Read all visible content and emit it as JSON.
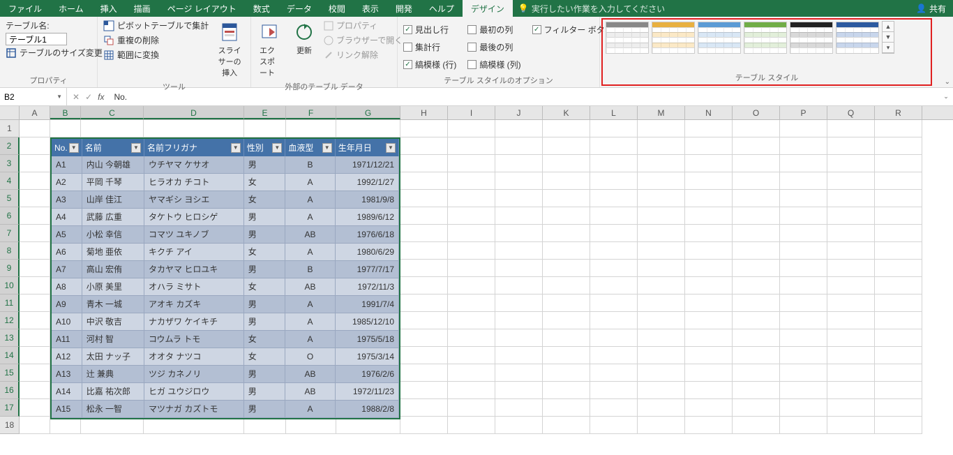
{
  "menu": {
    "tabs": [
      "ファイル",
      "ホーム",
      "挿入",
      "描画",
      "ページ レイアウト",
      "数式",
      "データ",
      "校閲",
      "表示",
      "開発",
      "ヘルプ",
      "デザイン"
    ],
    "active_index": 11,
    "tell_me": "実行したい作業を入力してください",
    "share": "共有"
  },
  "ribbon": {
    "properties": {
      "label": "プロパティ",
      "table_name_label": "テーブル名:",
      "table_name_value": "テーブル1",
      "resize": "テーブルのサイズ変更"
    },
    "tools": {
      "label": "ツール",
      "pivot": "ピボットテーブルで集計",
      "dedup": "重複の削除",
      "to_range": "範囲に変換",
      "slicer": "スライサーの\n挿入"
    },
    "external": {
      "label": "外部のテーブル データ",
      "export": "エクスポート",
      "refresh": "更新",
      "props": "プロパティ",
      "open_browser": "ブラウザーで開く",
      "unlink": "リンク解除"
    },
    "options": {
      "label": "テーブル スタイルのオプション",
      "header_row": "見出し行",
      "total_row": "集計行",
      "banded_rows": "縞模様 (行)",
      "first_col": "最初の列",
      "last_col": "最後の列",
      "banded_cols": "縞模様 (列)",
      "filter_btn": "フィルター ボタン"
    },
    "styles": {
      "label": "テーブル スタイル"
    }
  },
  "formula_bar": {
    "name_box": "B2",
    "fx": "fx",
    "formula": "No."
  },
  "grid": {
    "columns": [
      "A",
      "B",
      "C",
      "D",
      "E",
      "F",
      "G",
      "H",
      "I",
      "J",
      "K",
      "L",
      "M",
      "N",
      "O",
      "P",
      "Q",
      "R"
    ],
    "selected_cols": [
      "B",
      "C",
      "D",
      "E",
      "F",
      "G"
    ],
    "row_count": 18,
    "selected_rows_from": 2,
    "selected_rows_to": 17,
    "active_cell": {
      "row": 2,
      "col": "B"
    }
  },
  "table": {
    "headers": [
      "No.",
      "名前",
      "名前フリガナ",
      "性別",
      "血液型",
      "生年月日"
    ],
    "rows": [
      [
        "A1",
        "内山 今朝雄",
        "ウチヤマ ケサオ",
        "男",
        "B",
        "1971/12/21"
      ],
      [
        "A2",
        "平岡 千琴",
        "ヒラオカ チコト",
        "女",
        "A",
        "1992/1/27"
      ],
      [
        "A3",
        "山岸 佳江",
        "ヤマギシ ヨシエ",
        "女",
        "A",
        "1981/9/8"
      ],
      [
        "A4",
        "武藤 広重",
        "タケトウ ヒロシゲ",
        "男",
        "A",
        "1989/6/12"
      ],
      [
        "A5",
        "小松 幸信",
        "コマツ ユキノブ",
        "男",
        "AB",
        "1976/6/18"
      ],
      [
        "A6",
        "菊地 亜依",
        "キクチ アイ",
        "女",
        "A",
        "1980/6/29"
      ],
      [
        "A7",
        "高山 宏侑",
        "タカヤマ ヒロユキ",
        "男",
        "B",
        "1977/7/17"
      ],
      [
        "A8",
        "小原 美里",
        "オハラ ミサト",
        "女",
        "AB",
        "1972/11/3"
      ],
      [
        "A9",
        "青木 一城",
        "アオキ カズキ",
        "男",
        "A",
        "1991/7/4"
      ],
      [
        "A10",
        "中沢 敬吉",
        "ナカザワ ケイキチ",
        "男",
        "A",
        "1985/12/10"
      ],
      [
        "A11",
        "河村 智",
        "コウムラ トモ",
        "女",
        "A",
        "1975/5/18"
      ],
      [
        "A12",
        "太田 ナッ子",
        "オオタ ナツコ",
        "女",
        "O",
        "1975/3/14"
      ],
      [
        "A13",
        "辻 兼典",
        "ツジ カネノリ",
        "男",
        "AB",
        "1976/2/6"
      ],
      [
        "A14",
        "比嘉 祐次郎",
        "ヒガ ユウジロウ",
        "男",
        "AB",
        "1972/11/23"
      ],
      [
        "A15",
        "松永 一智",
        "マツナガ カズトモ",
        "男",
        "A",
        "1988/2/8"
      ]
    ]
  }
}
